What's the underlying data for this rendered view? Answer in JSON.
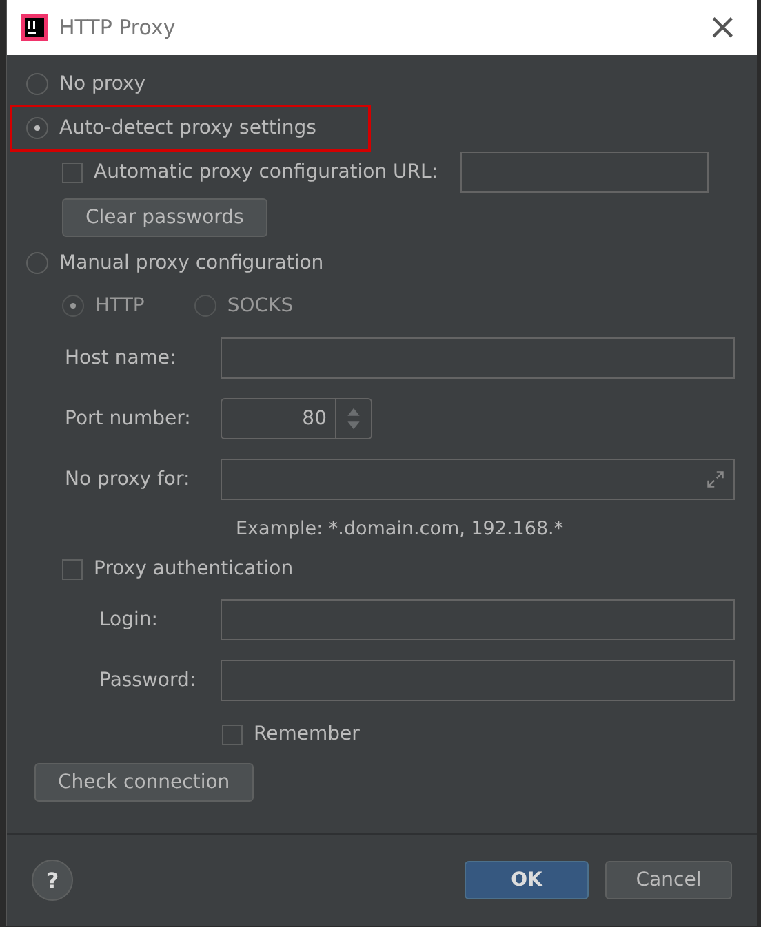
{
  "window": {
    "title": "HTTP Proxy",
    "close": "×"
  },
  "modes": [
    {
      "label": "No proxy",
      "selected": false,
      "highlighted": false
    },
    {
      "label": "Auto-detect proxy settings",
      "selected": true,
      "highlighted": true
    }
  ],
  "auto_config": {
    "label": "Automatic proxy configuration URL:",
    "checked": false
  },
  "clear_button": "Clear passwords",
  "manual_mode": {
    "label": "Manual proxy configuration",
    "selected": false
  },
  "protocols": [
    {
      "label": "HTTP",
      "selected": true,
      "disabled": true
    },
    {
      "label": "SOCKS",
      "selected": false,
      "disabled": true
    }
  ],
  "host": {
    "label": "Host name:"
  },
  "port": {
    "label": "Port number:",
    "value": "80"
  },
  "no_proxy": {
    "label": "No proxy for:",
    "hint": "Example: *.domain.com, 192.168.*"
  },
  "auth": {
    "label": "Proxy authentication",
    "checked": false
  },
  "login": {
    "label": "Login:"
  },
  "password": {
    "label": "Password:"
  },
  "remember": {
    "label": "Remember",
    "checked": false
  },
  "check_button": "Check connection",
  "footer": {
    "help": "?",
    "ok": "OK",
    "cancel": "Cancel"
  }
}
